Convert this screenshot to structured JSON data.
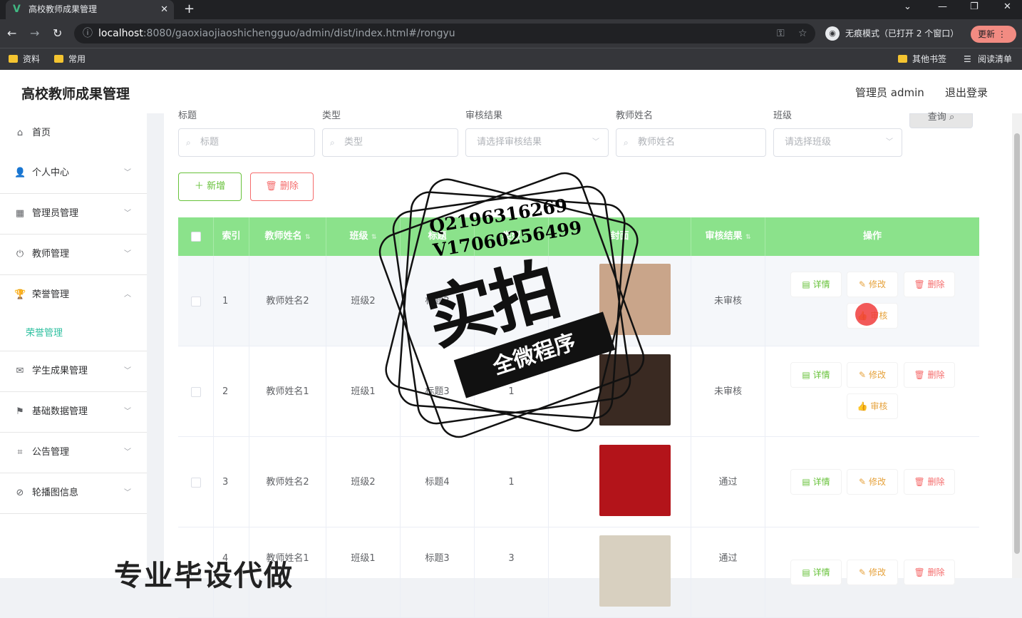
{
  "browser": {
    "tab_title": "高校教师成果管理",
    "url_host": "localhost",
    "url_path": ":8080/gaoxiaojiaoshichengguo/admin/dist/index.html#/rongyu",
    "incognito_label": "无痕模式（已打开 2 个窗口）",
    "update_label": "更新",
    "bookmarks": [
      "资料",
      "常用"
    ],
    "bookmarks_right": [
      "其他书签",
      "阅读清单"
    ]
  },
  "header": {
    "brand": "高校教师成果管理",
    "user": "管理员 admin",
    "logout": "退出登录"
  },
  "sidebar": {
    "items": [
      {
        "label": "首页",
        "icon": "home-icon"
      },
      {
        "label": "个人中心",
        "icon": "user-icon"
      },
      {
        "label": "管理员管理",
        "icon": "grid-icon"
      },
      {
        "label": "教师管理",
        "icon": "power-icon"
      },
      {
        "label": "荣誉管理",
        "icon": "trophy-icon"
      },
      {
        "label": "学生成果管理",
        "icon": "mail-icon"
      },
      {
        "label": "基础数据管理",
        "icon": "flag-icon"
      },
      {
        "label": "公告管理",
        "icon": "crop-icon"
      },
      {
        "label": "轮播图信息",
        "icon": "bell-off-icon"
      }
    ],
    "submenu_active": "荣誉管理"
  },
  "filters": {
    "title_label": "标题",
    "title_placeholder": "标题",
    "type_label": "类型",
    "type_placeholder": "类型",
    "audit_label": "审核结果",
    "audit_placeholder": "请选择审核结果",
    "teacher_label": "教师姓名",
    "teacher_placeholder": "教师姓名",
    "class_label": "班级",
    "class_placeholder": "请选择班级",
    "query_button": "查询"
  },
  "actions": {
    "add": "新增",
    "delete": "删除"
  },
  "table": {
    "headers": {
      "index": "索引",
      "teacher": "教师姓名",
      "class": "班级",
      "title": "标题",
      "type": "类型",
      "cover": "封面",
      "audit": "审核结果",
      "ops": "操作"
    },
    "ops": {
      "detail": "详情",
      "modify": "修改",
      "delete": "删除",
      "audit": "审核"
    },
    "rows": [
      {
        "index": "1",
        "teacher": "教师姓名2",
        "class": "班级2",
        "title": "标题2",
        "type": "3",
        "audit": "未审核",
        "cover_color": "#c9a58a"
      },
      {
        "index": "2",
        "teacher": "教师姓名1",
        "class": "班级1",
        "title": "标题3",
        "type": "1",
        "audit": "未审核",
        "cover_color": "#3a2a22"
      },
      {
        "index": "3",
        "teacher": "教师姓名2",
        "class": "班级2",
        "title": "标题4",
        "type": "1",
        "audit": "通过",
        "cover_color": "#b3141a"
      },
      {
        "index": "4",
        "teacher": "教师姓名1",
        "class": "班级1",
        "title": "标题3",
        "type": "3",
        "audit": "通过",
        "cover_color": "#d8d0c0"
      }
    ]
  },
  "watermark": {
    "contact1": "Q2196316269",
    "contact2": "V17060256499",
    "main": "实拍",
    "band": "全微程序",
    "bottom": "专业毕设代做"
  }
}
